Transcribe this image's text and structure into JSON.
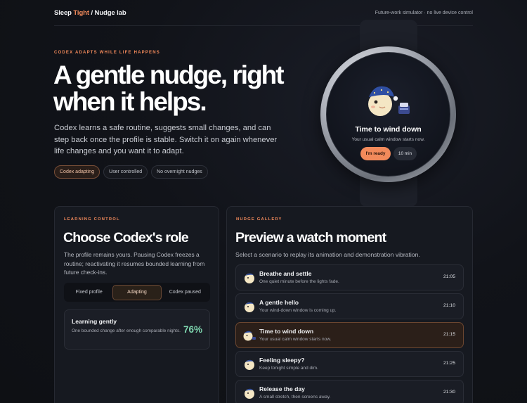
{
  "header": {
    "brand_part1": "Sleep ",
    "brand_accent": "Tight",
    "brand_part2": " / Nudge lab",
    "note": "Future-work simulator · no live device control"
  },
  "hero": {
    "eyebrow": "CODEX ADAPTS WHILE LIFE HAPPENS",
    "title": "A gentle nudge, right when it helps.",
    "subtitle": "Codex learns a safe routine, suggests small changes, and can step back once the profile is stable. Switch it on again whenever life changes and you want it to adapt.",
    "chips": [
      "Codex adapting",
      "User controlled",
      "No overnight nudges"
    ]
  },
  "watch": {
    "title": "Time to wind down",
    "subtitle": "Your usual calm window starts now.",
    "primary_label": "I'm ready",
    "secondary_label": "10 min"
  },
  "learning": {
    "eyebrow": "LEARNING CONTROL",
    "title": "Choose Codex's role",
    "subtitle": "The profile remains yours. Pausing Codex freezes a routine; reactivating it resumes bounded learning from future check-ins.",
    "options": [
      "Fixed profile",
      "Adapting",
      "Codex paused"
    ],
    "selected": "Adapting",
    "status_title": "Learning gently",
    "status_desc": "One bounded change after enough comparable nights.",
    "percent": "76%"
  },
  "gallery": {
    "eyebrow": "NUDGE GALLERY",
    "title": "Preview a watch moment",
    "subtitle": "Select a scenario to replay its animation and demonstration vibration.",
    "items": [
      {
        "title": "Breathe and settle",
        "desc": "One quiet minute before the lights fade.",
        "time": "21:05"
      },
      {
        "title": "A gentle hello",
        "desc": "Your wind-down window is coming up.",
        "time": "21:10"
      },
      {
        "title": "Time to wind down",
        "desc": "Your usual calm window starts now.",
        "time": "21:15"
      },
      {
        "title": "Feeling sleepy?",
        "desc": "Keep tonight simple and dim.",
        "time": "21:25"
      },
      {
        "title": "Release the day",
        "desc": "A small stretch, then screens away.",
        "time": "21:30"
      }
    ],
    "selected_index": 2
  },
  "colors": {
    "accent": "#f28a5b",
    "success": "#7fd7b0",
    "background": "#0f1115",
    "card": "#161920"
  }
}
